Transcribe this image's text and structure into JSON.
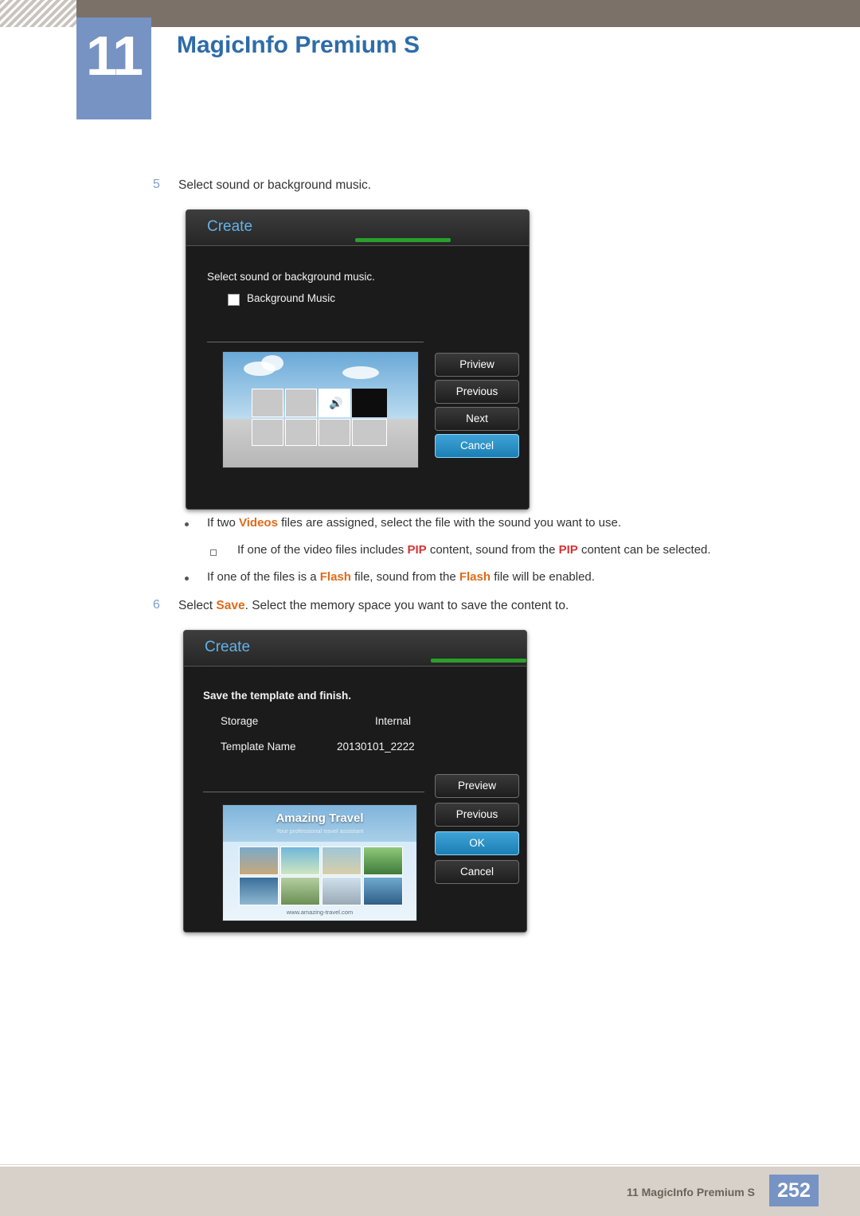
{
  "header": {
    "chapter_number": "11",
    "title": "MagicInfo Premium S"
  },
  "steps": [
    {
      "number": "5",
      "text": "Select sound or background music."
    },
    {
      "number": "6",
      "text_parts": [
        "Select ",
        "Save",
        ". Select the memory space you want to save the content to."
      ]
    }
  ],
  "step5": {
    "number": "5",
    "text": "Select sound or background music."
  },
  "step6": {
    "number": "6",
    "pre": "Select ",
    "keyword": "Save",
    "post": ". Select the memory space you want to save the content to."
  },
  "dialog_sound": {
    "title": "Create",
    "instruction": "Select sound or background music.",
    "checkbox_label": "Background Music",
    "buttons": [
      {
        "label": "Priview",
        "selected": false
      },
      {
        "label": "Previous",
        "selected": false
      },
      {
        "label": "Next",
        "selected": false
      },
      {
        "label": "Cancel",
        "selected": true
      }
    ]
  },
  "dialog_save": {
    "title": "Create",
    "instruction": "Save the template and finish.",
    "fields": [
      {
        "label": "Storage",
        "value": "Internal"
      },
      {
        "label": "Template Name",
        "value": "20130101_2222"
      }
    ],
    "buttons": [
      {
        "label": "Preview",
        "selected": false
      },
      {
        "label": "Previous",
        "selected": false
      },
      {
        "label": "OK",
        "selected": true
      },
      {
        "label": "Cancel",
        "selected": false
      }
    ],
    "thumbnail": {
      "title": "Amazing Travel",
      "subtitle": "Your professional travel assistant",
      "footer": "www.amazing-travel.com"
    }
  },
  "notes": [
    {
      "level": 1,
      "marker": "dot",
      "parts": [
        {
          "text": "If two "
        },
        {
          "text": "Videos",
          "style": "orange"
        },
        {
          "text": " files are assigned, select the file with the sound you want to use."
        }
      ]
    },
    {
      "level": 2,
      "marker": "square",
      "parts": [
        {
          "text": "If one of the video files includes "
        },
        {
          "text": "PIP",
          "style": "red"
        },
        {
          "text": " content, sound from the "
        },
        {
          "text": "PIP",
          "style": "red"
        },
        {
          "text": " content can be selected."
        }
      ]
    },
    {
      "level": 1,
      "marker": "dot",
      "parts": [
        {
          "text": "If one of the files is a "
        },
        {
          "text": "Flash",
          "style": "orange"
        },
        {
          "text": " file, sound from the "
        },
        {
          "text": "Flash",
          "style": "orange"
        },
        {
          "text": " file will be enabled."
        }
      ]
    }
  ],
  "note1": {
    "a": "If two ",
    "b": "Videos",
    "c": " files are assigned, select the file with the sound you want to use."
  },
  "note2": {
    "a": "If one of the video files includes ",
    "b": "PIP",
    "c": " content, sound from the ",
    "d": "PIP",
    "e": " content can be selected."
  },
  "note3": {
    "a": "If one of the files is a ",
    "b": "Flash",
    "c": " file, sound from the ",
    "d": "Flash",
    "e": " file will be enabled."
  },
  "footer": {
    "text": "11 MagicInfo Premium S",
    "page": "252"
  },
  "colors": {
    "accent_blue": "#7793c4",
    "title_blue": "#2e6ca8",
    "dialog_title": "#62b2e8",
    "green_bar": "#2aa02a",
    "selected_button": "#2f95cd",
    "orange_keyword": "#e06a1b",
    "red_keyword": "#d53434",
    "header_bar": "#7b7169",
    "footer_bar": "#d8d1c9"
  }
}
